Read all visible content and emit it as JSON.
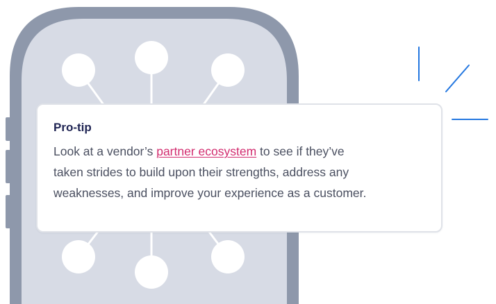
{
  "tip": {
    "title": "Pro-tip",
    "line1_before": "Look at a vendor’s",
    "link_text": "partner ecosystem",
    "line1_after": "to see if they’ve",
    "line2": "taken strides to build upon their strengths, address any",
    "line3": "weaknesses, and improve your experience as a customer."
  },
  "illustration": {
    "icon": "phone-network-icon",
    "spark_icon": "sparkle-icon"
  },
  "colors": {
    "phone_frame": "#8e98ab",
    "phone_screen": "#d7dbe5",
    "node_fill": "#ffffff",
    "spark": "#2377e0",
    "title": "#1f2453",
    "body_text": "#4a4f60",
    "link": "#d22b6e"
  }
}
